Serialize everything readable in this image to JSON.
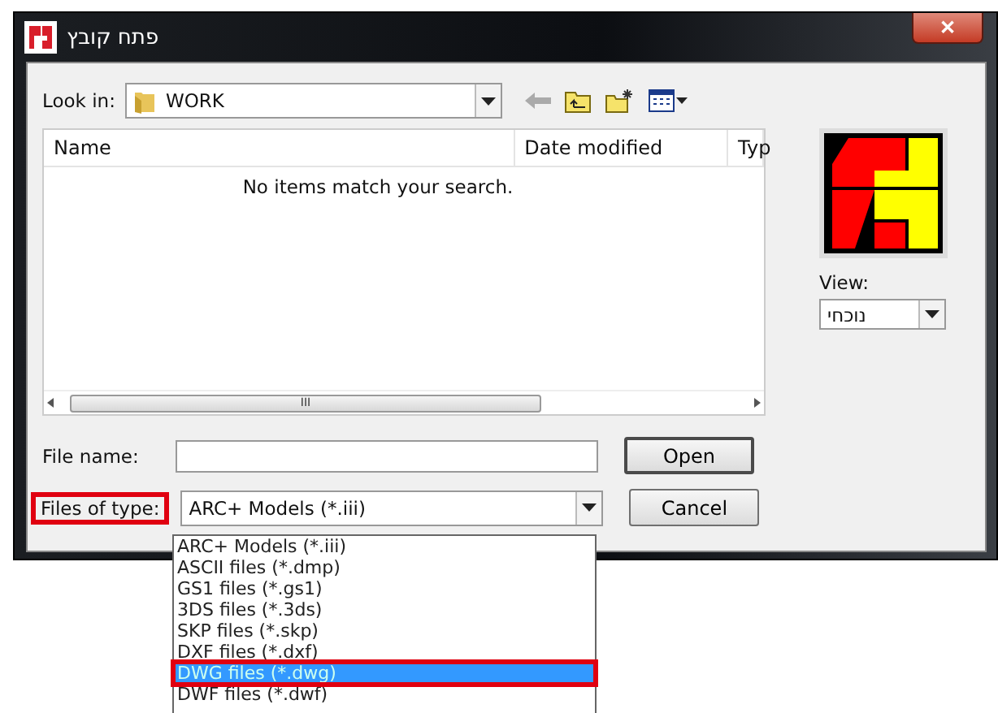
{
  "window": {
    "title": "פתח קובץ",
    "close": "✕"
  },
  "look_in": {
    "label": "Look in:",
    "value": "WORK"
  },
  "file_list": {
    "columns": [
      "Name",
      "Date modified",
      "Typ"
    ],
    "empty_message": "No items match your search.",
    "scroll_grip": "III"
  },
  "preview": {
    "view_label": "View:",
    "view_value": "נוכחי"
  },
  "file_name": {
    "label": "File name:"
  },
  "files_of_type": {
    "label": "Files of type:",
    "annotated": true,
    "value": "ARC+ Models (*.iii)"
  },
  "buttons": [
    {
      "label": "Open",
      "default": true
    },
    {
      "label": "Cancel",
      "default": false
    }
  ],
  "type_options": [
    {
      "label": "ARC+ Models (*.iii)",
      "selected": false,
      "annotated": false
    },
    {
      "label": "ASCII files (*.dmp)",
      "selected": false,
      "annotated": false
    },
    {
      "label": "GS1 files (*.gs1)",
      "selected": false,
      "annotated": false
    },
    {
      "label": "3DS files (*.3ds)",
      "selected": false,
      "annotated": false
    },
    {
      "label": "SKP files (*.skp)",
      "selected": false,
      "annotated": false
    },
    {
      "label": "DXF files (*.dxf)",
      "selected": false,
      "annotated": false
    },
    {
      "label": "DWG files (*.dwg)",
      "selected": true,
      "annotated": true
    },
    {
      "label": "DWF files (*.dwf)",
      "selected": false,
      "annotated": false
    }
  ]
}
